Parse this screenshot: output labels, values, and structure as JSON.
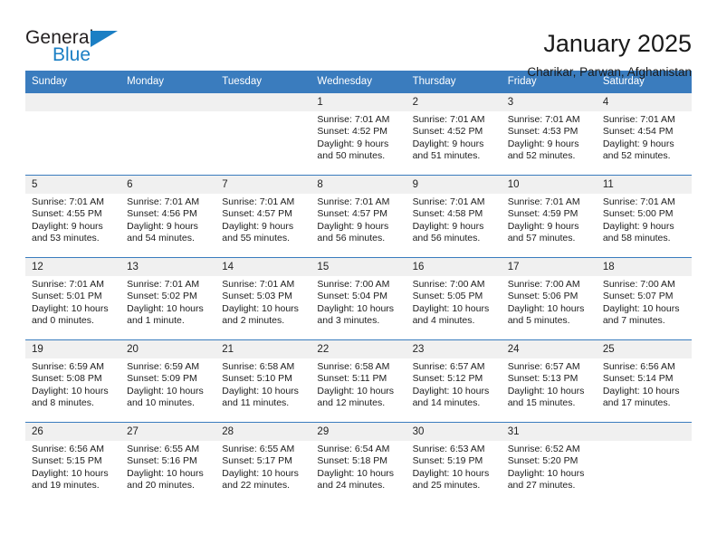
{
  "brand": {
    "name_part1": "General",
    "name_part2": "Blue",
    "flag_icon": "triangle-flag-icon"
  },
  "header": {
    "title": "January 2025",
    "subtitle": "Charikar, Parwan, Afghanistan"
  },
  "colors": {
    "header_blue": "#3a7cbe",
    "brand_blue": "#1b7fc4",
    "daynum_band": "#f0f0f0",
    "text": "#1c1c1c"
  },
  "weekdays": [
    "Sunday",
    "Monday",
    "Tuesday",
    "Wednesday",
    "Thursday",
    "Friday",
    "Saturday"
  ],
  "weeks": [
    [
      {
        "day": "",
        "empty": true
      },
      {
        "day": "",
        "empty": true
      },
      {
        "day": "",
        "empty": true
      },
      {
        "day": "1",
        "sunrise": "Sunrise: 7:01 AM",
        "sunset": "Sunset: 4:52 PM",
        "daylight1": "Daylight: 9 hours",
        "daylight2": "and 50 minutes."
      },
      {
        "day": "2",
        "sunrise": "Sunrise: 7:01 AM",
        "sunset": "Sunset: 4:52 PM",
        "daylight1": "Daylight: 9 hours",
        "daylight2": "and 51 minutes."
      },
      {
        "day": "3",
        "sunrise": "Sunrise: 7:01 AM",
        "sunset": "Sunset: 4:53 PM",
        "daylight1": "Daylight: 9 hours",
        "daylight2": "and 52 minutes."
      },
      {
        "day": "4",
        "sunrise": "Sunrise: 7:01 AM",
        "sunset": "Sunset: 4:54 PM",
        "daylight1": "Daylight: 9 hours",
        "daylight2": "and 52 minutes."
      }
    ],
    [
      {
        "day": "5",
        "sunrise": "Sunrise: 7:01 AM",
        "sunset": "Sunset: 4:55 PM",
        "daylight1": "Daylight: 9 hours",
        "daylight2": "and 53 minutes."
      },
      {
        "day": "6",
        "sunrise": "Sunrise: 7:01 AM",
        "sunset": "Sunset: 4:56 PM",
        "daylight1": "Daylight: 9 hours",
        "daylight2": "and 54 minutes."
      },
      {
        "day": "7",
        "sunrise": "Sunrise: 7:01 AM",
        "sunset": "Sunset: 4:57 PM",
        "daylight1": "Daylight: 9 hours",
        "daylight2": "and 55 minutes."
      },
      {
        "day": "8",
        "sunrise": "Sunrise: 7:01 AM",
        "sunset": "Sunset: 4:57 PM",
        "daylight1": "Daylight: 9 hours",
        "daylight2": "and 56 minutes."
      },
      {
        "day": "9",
        "sunrise": "Sunrise: 7:01 AM",
        "sunset": "Sunset: 4:58 PM",
        "daylight1": "Daylight: 9 hours",
        "daylight2": "and 56 minutes."
      },
      {
        "day": "10",
        "sunrise": "Sunrise: 7:01 AM",
        "sunset": "Sunset: 4:59 PM",
        "daylight1": "Daylight: 9 hours",
        "daylight2": "and 57 minutes."
      },
      {
        "day": "11",
        "sunrise": "Sunrise: 7:01 AM",
        "sunset": "Sunset: 5:00 PM",
        "daylight1": "Daylight: 9 hours",
        "daylight2": "and 58 minutes."
      }
    ],
    [
      {
        "day": "12",
        "sunrise": "Sunrise: 7:01 AM",
        "sunset": "Sunset: 5:01 PM",
        "daylight1": "Daylight: 10 hours",
        "daylight2": "and 0 minutes."
      },
      {
        "day": "13",
        "sunrise": "Sunrise: 7:01 AM",
        "sunset": "Sunset: 5:02 PM",
        "daylight1": "Daylight: 10 hours",
        "daylight2": "and 1 minute."
      },
      {
        "day": "14",
        "sunrise": "Sunrise: 7:01 AM",
        "sunset": "Sunset: 5:03 PM",
        "daylight1": "Daylight: 10 hours",
        "daylight2": "and 2 minutes."
      },
      {
        "day": "15",
        "sunrise": "Sunrise: 7:00 AM",
        "sunset": "Sunset: 5:04 PM",
        "daylight1": "Daylight: 10 hours",
        "daylight2": "and 3 minutes."
      },
      {
        "day": "16",
        "sunrise": "Sunrise: 7:00 AM",
        "sunset": "Sunset: 5:05 PM",
        "daylight1": "Daylight: 10 hours",
        "daylight2": "and 4 minutes."
      },
      {
        "day": "17",
        "sunrise": "Sunrise: 7:00 AM",
        "sunset": "Sunset: 5:06 PM",
        "daylight1": "Daylight: 10 hours",
        "daylight2": "and 5 minutes."
      },
      {
        "day": "18",
        "sunrise": "Sunrise: 7:00 AM",
        "sunset": "Sunset: 5:07 PM",
        "daylight1": "Daylight: 10 hours",
        "daylight2": "and 7 minutes."
      }
    ],
    [
      {
        "day": "19",
        "sunrise": "Sunrise: 6:59 AM",
        "sunset": "Sunset: 5:08 PM",
        "daylight1": "Daylight: 10 hours",
        "daylight2": "and 8 minutes."
      },
      {
        "day": "20",
        "sunrise": "Sunrise: 6:59 AM",
        "sunset": "Sunset: 5:09 PM",
        "daylight1": "Daylight: 10 hours",
        "daylight2": "and 10 minutes."
      },
      {
        "day": "21",
        "sunrise": "Sunrise: 6:58 AM",
        "sunset": "Sunset: 5:10 PM",
        "daylight1": "Daylight: 10 hours",
        "daylight2": "and 11 minutes."
      },
      {
        "day": "22",
        "sunrise": "Sunrise: 6:58 AM",
        "sunset": "Sunset: 5:11 PM",
        "daylight1": "Daylight: 10 hours",
        "daylight2": "and 12 minutes."
      },
      {
        "day": "23",
        "sunrise": "Sunrise: 6:57 AM",
        "sunset": "Sunset: 5:12 PM",
        "daylight1": "Daylight: 10 hours",
        "daylight2": "and 14 minutes."
      },
      {
        "day": "24",
        "sunrise": "Sunrise: 6:57 AM",
        "sunset": "Sunset: 5:13 PM",
        "daylight1": "Daylight: 10 hours",
        "daylight2": "and 15 minutes."
      },
      {
        "day": "25",
        "sunrise": "Sunrise: 6:56 AM",
        "sunset": "Sunset: 5:14 PM",
        "daylight1": "Daylight: 10 hours",
        "daylight2": "and 17 minutes."
      }
    ],
    [
      {
        "day": "26",
        "sunrise": "Sunrise: 6:56 AM",
        "sunset": "Sunset: 5:15 PM",
        "daylight1": "Daylight: 10 hours",
        "daylight2": "and 19 minutes."
      },
      {
        "day": "27",
        "sunrise": "Sunrise: 6:55 AM",
        "sunset": "Sunset: 5:16 PM",
        "daylight1": "Daylight: 10 hours",
        "daylight2": "and 20 minutes."
      },
      {
        "day": "28",
        "sunrise": "Sunrise: 6:55 AM",
        "sunset": "Sunset: 5:17 PM",
        "daylight1": "Daylight: 10 hours",
        "daylight2": "and 22 minutes."
      },
      {
        "day": "29",
        "sunrise": "Sunrise: 6:54 AM",
        "sunset": "Sunset: 5:18 PM",
        "daylight1": "Daylight: 10 hours",
        "daylight2": "and 24 minutes."
      },
      {
        "day": "30",
        "sunrise": "Sunrise: 6:53 AM",
        "sunset": "Sunset: 5:19 PM",
        "daylight1": "Daylight: 10 hours",
        "daylight2": "and 25 minutes."
      },
      {
        "day": "31",
        "sunrise": "Sunrise: 6:52 AM",
        "sunset": "Sunset: 5:20 PM",
        "daylight1": "Daylight: 10 hours",
        "daylight2": "and 27 minutes."
      },
      {
        "day": "",
        "empty": true
      }
    ]
  ]
}
